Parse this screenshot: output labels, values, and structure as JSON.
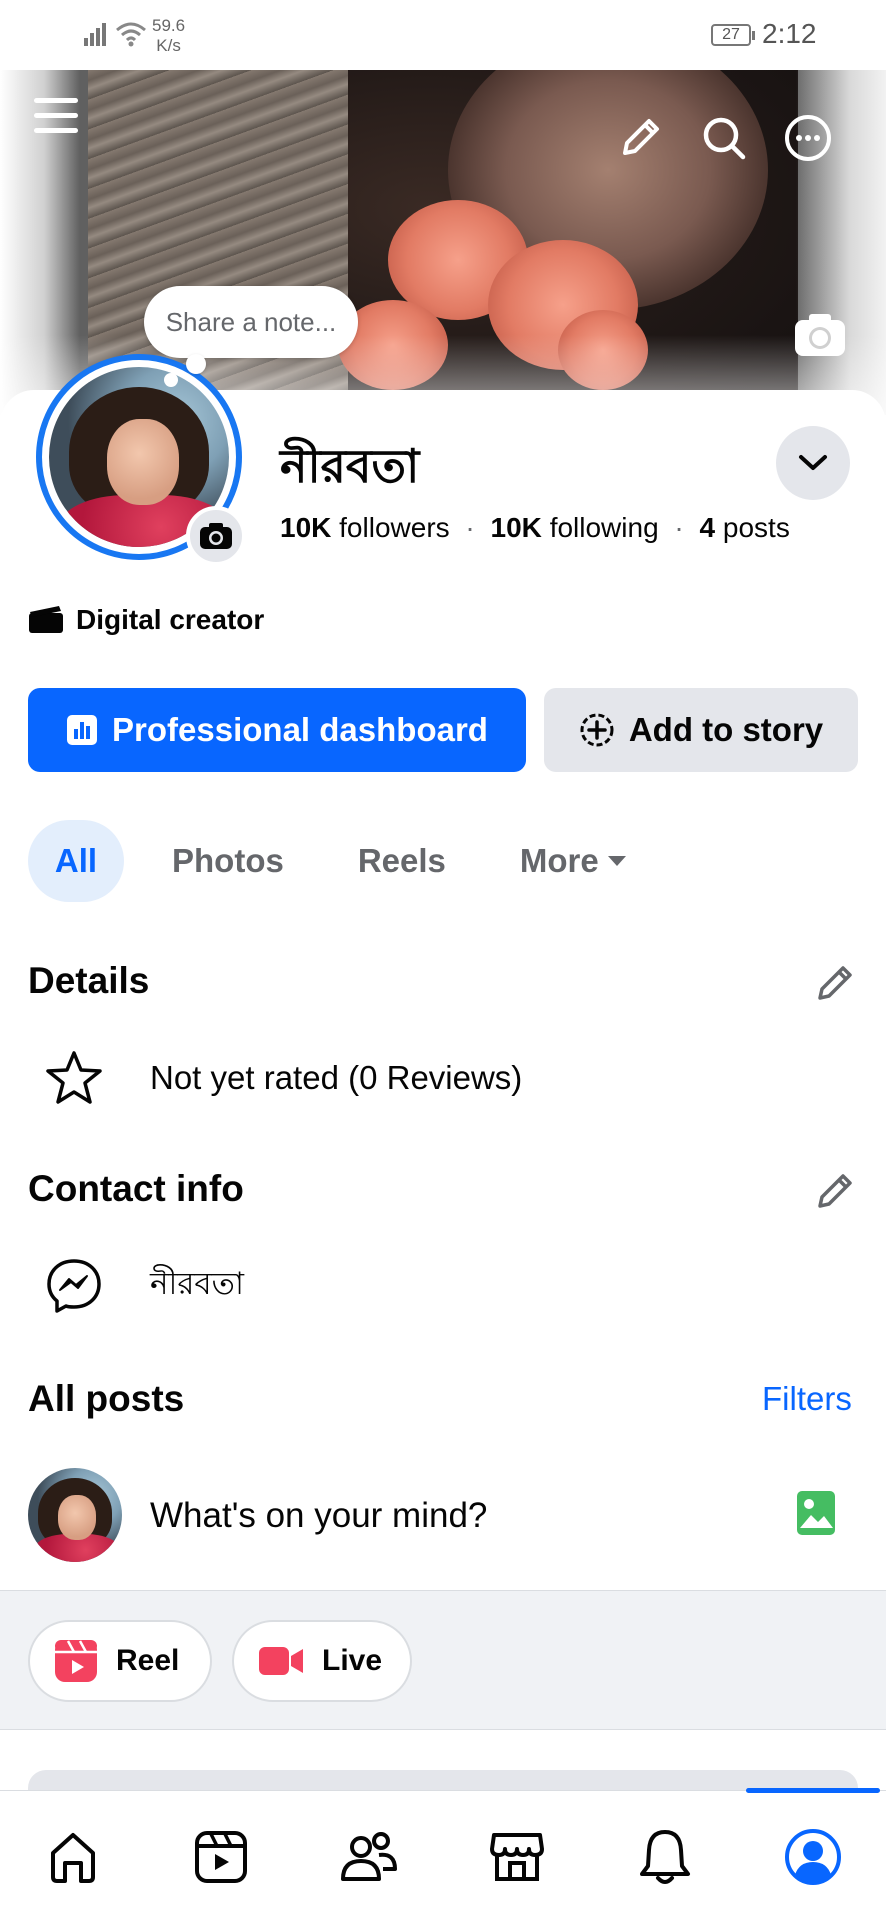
{
  "status_bar": {
    "network_speed_value": "59.6",
    "network_speed_unit": "K/s",
    "battery": "27",
    "time": "2:12"
  },
  "cover": {
    "icons": [
      "menu-icon",
      "pencil-icon",
      "search-icon",
      "more-icon",
      "camera-icon"
    ]
  },
  "note_bubble": {
    "placeholder": "Share a note..."
  },
  "profile": {
    "name": "নীরবতা",
    "followers_count": "10K",
    "followers_label": "followers",
    "following_count": "10K",
    "following_label": "following",
    "posts_count": "4",
    "posts_label": "posts",
    "category": "Digital creator"
  },
  "actions": {
    "primary_label": "Professional dashboard",
    "secondary_label": "Add to story"
  },
  "tabs": [
    {
      "label": "All",
      "active": true
    },
    {
      "label": "Photos",
      "active": false
    },
    {
      "label": "Reels",
      "active": false
    },
    {
      "label": "More",
      "active": false
    }
  ],
  "details": {
    "title": "Details",
    "rating_text": "Not yet rated (0 Reviews)"
  },
  "contact": {
    "title": "Contact info",
    "messenger_name": "নীরবতা"
  },
  "posts": {
    "title": "All posts",
    "filters_label": "Filters",
    "composer_placeholder": "What's on your mind?"
  },
  "chips": {
    "reel_label": "Reel",
    "live_label": "Live"
  },
  "bottom_nav": [
    "home-icon",
    "video-icon",
    "friends-icon",
    "marketplace-icon",
    "notifications-icon",
    "profile-icon"
  ],
  "colors": {
    "accent": "#0866ff",
    "secondary_button": "#e4e6eb",
    "text_secondary": "#65676b",
    "reel_red": "#f3425f",
    "photo_green": "#45bd62"
  }
}
